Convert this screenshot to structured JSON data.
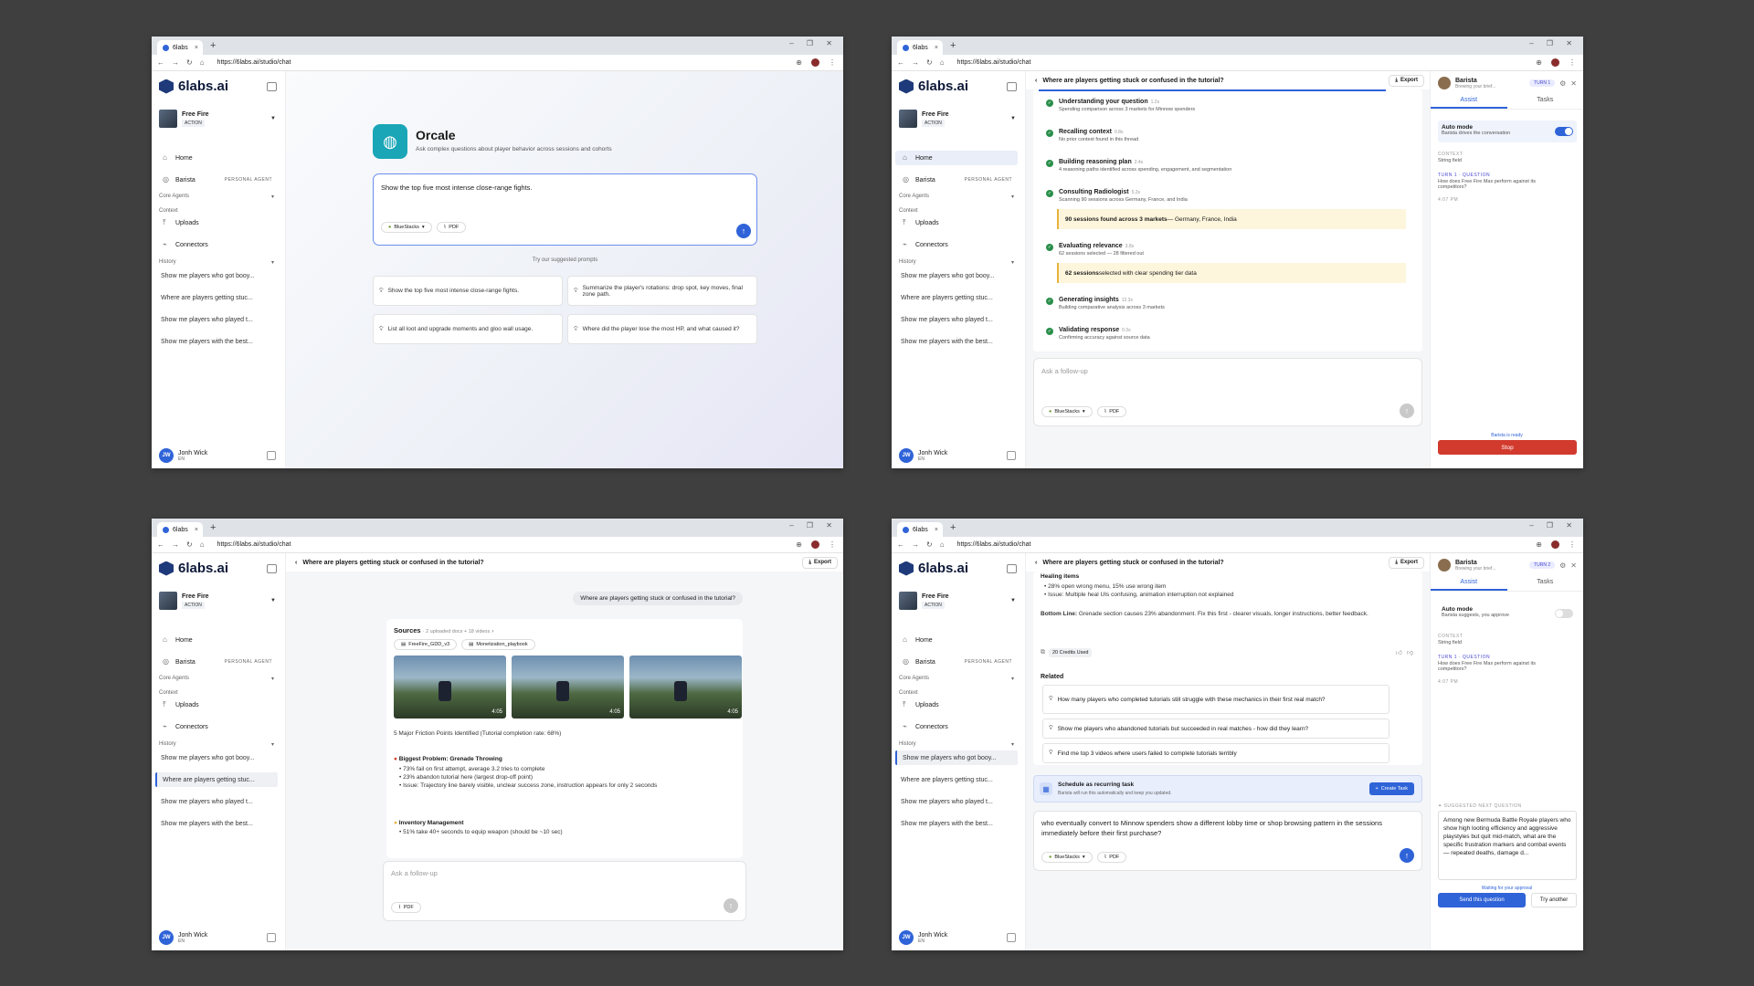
{
  "browser": {
    "tab_title": "6labs",
    "url": "https://6labs.ai/studio/chat",
    "new_tab": "+",
    "close": "×"
  },
  "sidebar": {
    "brand": "6labs.ai",
    "game_name": "Free Fire",
    "game_tag": "ACTION",
    "nav_home": "Home",
    "nav_barista": "Barista",
    "barista_tag": "PERSONAL AGENT",
    "core_agents": "Core Agents",
    "context": "Context",
    "uploads": "Uploads",
    "connectors": "Connectors",
    "history": "History",
    "history_items": [
      "Show me players who got booy...",
      "Where are players getting stuc...",
      "Show me players who played t...",
      "Show me players with the best..."
    ],
    "user_initials": "JW",
    "user_name": "Jonh Wick",
    "user_lang": "EN"
  },
  "w1": {
    "title": "Orcale",
    "subtitle": "Ask complex questions about player behavior across sessions and cohorts",
    "input_value": "Show the top five most intense close-range fights.",
    "bluestacks": "BlueStacks",
    "pdf": "PDF",
    "suggest_label": "Try our suggested prompts",
    "prompts": [
      "Show the top five most intense close-range fights.",
      "Summarize the player's rotations: drop spot, key moves, final zone path.",
      "List all loot and upgrade moments and gloo wall usage.",
      "Where did the player lose the most HP, and what caused it?"
    ]
  },
  "chat": {
    "question": "Where are players getting stuck or confused in the tutorial?",
    "export": "Export",
    "follow_placeholder": "Ask a follow-up"
  },
  "w2": {
    "steps": [
      {
        "title": "Understanding your question",
        "time": "1.2s",
        "desc": "Spending comparison across 3 markets for Minnow spenders"
      },
      {
        "title": "Recalling context",
        "time": "0.8s",
        "desc": "No prior context found in this thread"
      },
      {
        "title": "Building reasoning plan",
        "time": "2.4s",
        "desc": "4 reasoning paths identified across spending, engagement, and segmentation"
      },
      {
        "title": "Consulting Radiologist",
        "time": "5.2s",
        "desc": "Scanning 90 sessions across Germany, France, and India"
      },
      {
        "title": "Evaluating relevance",
        "time": "3.8s",
        "desc": "62 sessions selected — 28 filtered out"
      },
      {
        "title": "Generating insights",
        "time": "12.3s",
        "desc": "Building comparative analysis across 3 markets"
      },
      {
        "title": "Validating response",
        "time": "0.3s",
        "desc": "Confirming accuracy against source data"
      }
    ],
    "hl1_bold": "90 sessions found across 3 markets",
    "hl1_rest": " — Germany, France, India",
    "hl2_bold": "62 sessions",
    "hl2_rest": " selected with clear spending tier data"
  },
  "barista_panel": {
    "name": "Barista",
    "status": "Brewing your brief...",
    "turn1": "TURN 1",
    "turn2": "TURN 2",
    "tab_assist": "Assist",
    "tab_tasks": "Tasks",
    "auto_mode": "Auto mode",
    "auto_on_desc": "Barista drives the conversation",
    "auto_off_desc": "Barista suggests, you approve",
    "context_label": "CONTEXT",
    "context_value": "String field",
    "turn_question_label": "TURN 1 · QUESTION",
    "turn_question": "How does Free Fire Max perform against its competitors?",
    "turn_time": "4:07 PM",
    "ready": "Barista is ready",
    "stop": "Stop",
    "suggested_label": "SUGGESTED NEXT QUESTION",
    "suggested_text": "Among new Bermuda Battle Royale players who show high looting efficiency and aggressive playstyles but quit mid-match, what are the specific frustration markers and combat events — repeated deaths, damage d...",
    "waiting": "Waiting for your approval",
    "send_q": "Send this question",
    "try_another": "Try another"
  },
  "w3": {
    "sources_title": "Sources",
    "sources_sub": "· 2 uploaded docs + 18 videos",
    "doc1": "FreeFire_GDD_v3",
    "doc2": "Monetization_playbook",
    "durations": [
      "4:05",
      "4:05",
      "4:05"
    ],
    "headline": "5 Major Friction Points Identified (Tutorial completion rate: 68%)",
    "p1_title": "Biggest Problem: Grenade Throwing",
    "p1_bullets": [
      "73% fail on first attempt, average 3.2 tries to complete",
      "23% abandon tutorial here (largest drop-off point)",
      "Issue: Trajectory line barely visible, unclear success zone, instruction appears for only 2 seconds"
    ],
    "p2_title": "Inventory Management",
    "p2_bullets": [
      "51% take 40+ seconds to equip weapon (should be ~10 sec)"
    ]
  },
  "w4": {
    "heal_title": "Healing items",
    "heal_bullets": [
      "28% open wrong menu, 15% use wrong item",
      "Issue: Multiple heal UIs confusing, animation interruption not explained"
    ],
    "bottom_line_label": "Bottom Line:",
    "bottom_line": "Grenade section causes 23% abandonment. Fix this first - clearer visuals, longer instructions, better feedback.",
    "credits": "20 Credits Used",
    "related_title": "Related",
    "related": [
      "How many players who completed tutorials still struggle with these mechanics in their first real match?",
      "Show me players who abandoned tutorials but succeeded in real matches - how did they learn?",
      "Find me top 3 videos where users failed to complete tutorials terribly"
    ],
    "schedule_title": "Schedule as recurring task",
    "schedule_desc": "Barista will run this automatically and keep you updated.",
    "create_task": "Create Task",
    "followup_text": "who eventually convert to Minnow spenders show a different lobby time or shop browsing pattern in the sessions immediately before their first purchase?"
  }
}
